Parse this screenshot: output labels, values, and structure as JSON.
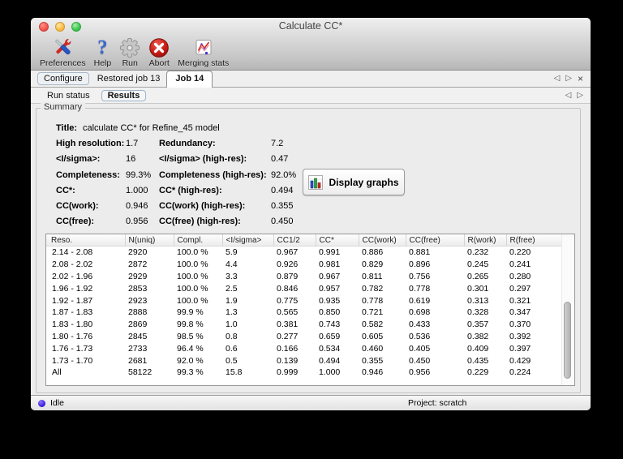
{
  "window": {
    "title": "Calculate CC*"
  },
  "icons": {
    "scroll_left": "◁",
    "scroll_right": "▷",
    "close_tab": "×"
  },
  "colors": {
    "abort_red": "#c01414",
    "help_blue": "#3a6bd0",
    "status_dot_blue": "#3416d8",
    "bar_blue": "#2a4fd0",
    "bar_green": "#23a63c",
    "bar_red": "#cc2a22"
  },
  "toolbar": {
    "items": [
      {
        "label": "Preferences",
        "icon": "preferences-tools-icon"
      },
      {
        "label": "Help",
        "icon": "help-question-icon"
      },
      {
        "label": "Run",
        "icon": "run-gear-icon"
      },
      {
        "label": "Abort",
        "icon": "abort-icon"
      },
      {
        "label": "Merging stats",
        "icon": "merging-stats-icon"
      }
    ]
  },
  "tabs": {
    "job_tabs": [
      {
        "label": "Configure",
        "selected": false
      },
      {
        "label": "Restored job 13",
        "selected": false
      },
      {
        "label": "Job 14",
        "selected": true
      }
    ],
    "sub_tabs": [
      {
        "label": "Run status",
        "selected": false
      },
      {
        "label": "Results",
        "selected": true
      }
    ]
  },
  "summary": {
    "section_label": "Summary",
    "title_label": "Title:",
    "title_value": "calculate CC* for Refine_45 model",
    "rows": [
      {
        "l1": "High resolution:",
        "v1": "1.7",
        "l2": "Redundancy:",
        "v2": "7.2"
      },
      {
        "l1": "<I/sigma>:",
        "v1": "16",
        "l2": "<I/sigma> (high-res):",
        "v2": "0.47"
      },
      {
        "l1": "Completeness:",
        "v1": "99.3%",
        "l2": "Completeness (high-res):",
        "v2": "92.0%"
      },
      {
        "l1": "CC*:",
        "v1": "1.000",
        "l2": "CC* (high-res):",
        "v2": "0.494"
      },
      {
        "l1": "CC(work):",
        "v1": "0.946",
        "l2": "CC(work) (high-res):",
        "v2": "0.355"
      },
      {
        "l1": "CC(free):",
        "v1": "0.956",
        "l2": "CC(free) (high-res):",
        "v2": "0.450"
      }
    ],
    "display_graphs_button": "Display graphs"
  },
  "table": {
    "columns": [
      "Reso.",
      "N(uniq)",
      "Compl.",
      "<I/sigma>",
      "CC1/2",
      "CC*",
      "CC(work)",
      "CC(free)",
      "R(work)",
      "R(free)"
    ],
    "rows": [
      [
        "2.14 - 2.08",
        "2920",
        "100.0 %",
        "5.9",
        "0.967",
        "0.991",
        "0.886",
        "0.881",
        "0.232",
        "0.220"
      ],
      [
        "2.08 - 2.02",
        "2872",
        "100.0 %",
        "4.4",
        "0.926",
        "0.981",
        "0.829",
        "0.896",
        "0.245",
        "0.241"
      ],
      [
        "2.02 - 1.96",
        "2929",
        "100.0 %",
        "3.3",
        "0.879",
        "0.967",
        "0.811",
        "0.756",
        "0.265",
        "0.280"
      ],
      [
        "1.96 - 1.92",
        "2853",
        "100.0 %",
        "2.5",
        "0.846",
        "0.957",
        "0.782",
        "0.778",
        "0.301",
        "0.297"
      ],
      [
        "1.92 - 1.87",
        "2923",
        "100.0 %",
        "1.9",
        "0.775",
        "0.935",
        "0.778",
        "0.619",
        "0.313",
        "0.321"
      ],
      [
        "1.87 - 1.83",
        "2888",
        "99.9 %",
        "1.3",
        "0.565",
        "0.850",
        "0.721",
        "0.698",
        "0.328",
        "0.347"
      ],
      [
        "1.83 - 1.80",
        "2869",
        "99.8 %",
        "1.0",
        "0.381",
        "0.743",
        "0.582",
        "0.433",
        "0.357",
        "0.370"
      ],
      [
        "1.80 - 1.76",
        "2845",
        "98.5 %",
        "0.8",
        "0.277",
        "0.659",
        "0.605",
        "0.536",
        "0.382",
        "0.392"
      ],
      [
        "1.76 - 1.73",
        "2733",
        "96.4 %",
        "0.6",
        "0.166",
        "0.534",
        "0.460",
        "0.405",
        "0.409",
        "0.397"
      ],
      [
        "1.73 - 1.70",
        "2681",
        "92.0 %",
        "0.5",
        "0.139",
        "0.494",
        "0.355",
        "0.450",
        "0.435",
        "0.429"
      ],
      [
        "All",
        "58122",
        "99.3 %",
        "15.8",
        "0.999",
        "1.000",
        "0.946",
        "0.956",
        "0.229",
        "0.224"
      ]
    ]
  },
  "status_bar": {
    "status": "Idle",
    "project": "Project: scratch"
  }
}
